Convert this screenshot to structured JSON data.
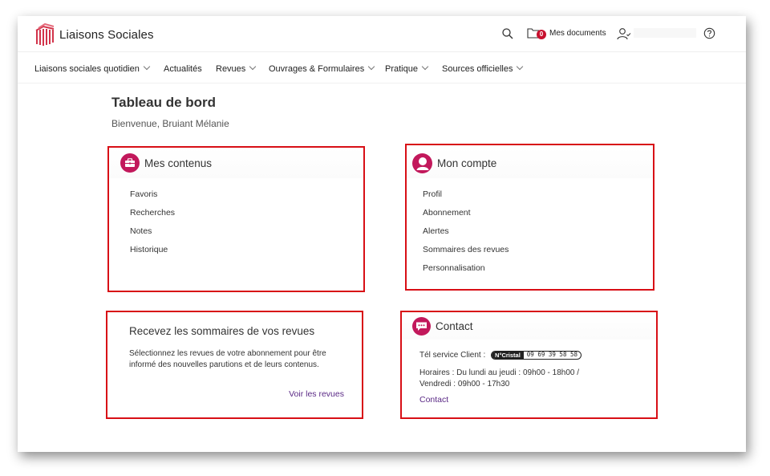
{
  "brand": {
    "name": "Liaisons Sociales",
    "accent": "#c2185b",
    "highlight_border": "#d80f16"
  },
  "header": {
    "search_icon": "search-icon",
    "documents_count": "0",
    "documents_label": "Mes documents",
    "user_icon": "user-check-icon",
    "help_icon": "help-circle-icon"
  },
  "nav": {
    "items": [
      {
        "label": "Liaisons sociales quotidien",
        "has_dropdown": true
      },
      {
        "label": "Actualités",
        "has_dropdown": false
      },
      {
        "label": "Revues",
        "has_dropdown": true
      },
      {
        "label": "Ouvrages & Formulaires",
        "has_dropdown": true
      },
      {
        "label": "Pratique",
        "has_dropdown": true
      },
      {
        "label": "Sources officielles",
        "has_dropdown": true
      }
    ]
  },
  "page": {
    "title": "Tableau de bord",
    "welcome": "Bienvenue, Bruiant Mélanie"
  },
  "mes_contenus": {
    "title": "Mes contenus",
    "icon": "briefcase-icon",
    "links": [
      "Favoris",
      "Recherches",
      "Notes",
      "Historique"
    ]
  },
  "mon_compte": {
    "title": "Mon compte",
    "icon": "user-icon",
    "links": [
      "Profil",
      "Abonnement",
      "Alertes",
      "Sommaires des revues",
      "Personnalisation"
    ]
  },
  "sommaires": {
    "title": "Recevez les sommaires de vos revues",
    "body": "Sélectionnez les revues de votre abonnement pour être informé des nouvelles parutions et de leurs contenus.",
    "link": "Voir les revues"
  },
  "contact": {
    "title": "Contact",
    "icon": "chat-bubble-icon",
    "phone_label": "Tél service Client :",
    "cristal_label": "N°Cristal",
    "phone_number": "09 69 39 58 58",
    "hours_line1": "Horaires : Du lundi au jeudi : 09h00 - 18h00 /",
    "hours_line2": "Vendredi : 09h00 - 17h30",
    "link": "Contact"
  }
}
